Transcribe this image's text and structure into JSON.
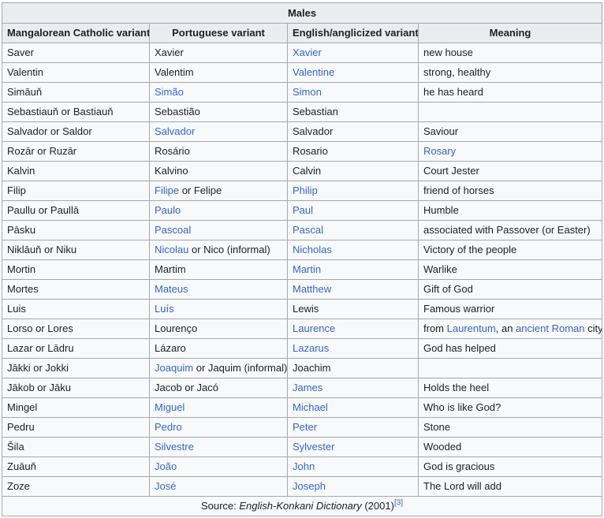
{
  "table": {
    "title": "Males",
    "headers": [
      "Mangalorean Catholic variant",
      "Portuguese variant",
      "English/anglicized variant",
      "Meaning"
    ],
    "rows": [
      [
        [
          {
            "t": "Saver"
          }
        ],
        [
          {
            "t": "Xavier"
          }
        ],
        [
          {
            "t": "Xavier",
            "link": true
          }
        ],
        [
          {
            "t": "new house"
          }
        ]
      ],
      [
        [
          {
            "t": "Valentin"
          }
        ],
        [
          {
            "t": "Valentim"
          }
        ],
        [
          {
            "t": "Valentine",
            "link": true
          }
        ],
        [
          {
            "t": "strong, healthy"
          }
        ]
      ],
      [
        [
          {
            "t": "Simāuň"
          }
        ],
        [
          {
            "t": "Simão",
            "link": true
          }
        ],
        [
          {
            "t": "Simon",
            "link": true
          }
        ],
        [
          {
            "t": "he has heard"
          }
        ]
      ],
      [
        [
          {
            "t": "Sebastiauň or Bastiauň"
          }
        ],
        [
          {
            "t": "Sebastião"
          }
        ],
        [
          {
            "t": "Sebastian"
          }
        ],
        []
      ],
      [
        [
          {
            "t": "Salvador or Saldor"
          }
        ],
        [
          {
            "t": "Salvador",
            "link": true
          }
        ],
        [
          {
            "t": "Salvador"
          }
        ],
        [
          {
            "t": "Saviour"
          }
        ]
      ],
      [
        [
          {
            "t": "Rozār or Ruzār"
          }
        ],
        [
          {
            "t": "Rosário"
          }
        ],
        [
          {
            "t": "Rosario"
          }
        ],
        [
          {
            "t": "Rosary",
            "link": true
          }
        ]
      ],
      [
        [
          {
            "t": "Kalvin"
          }
        ],
        [
          {
            "t": "Kalvino"
          }
        ],
        [
          {
            "t": "Calvin"
          }
        ],
        [
          {
            "t": "Court Jester"
          }
        ]
      ],
      [
        [
          {
            "t": "Filip"
          }
        ],
        [
          {
            "t": "Filipe",
            "link": true
          },
          {
            "t": " or Felipe"
          }
        ],
        [
          {
            "t": "Philip",
            "link": true
          }
        ],
        [
          {
            "t": "friend of horses"
          }
        ]
      ],
      [
        [
          {
            "t": "Paullu or Paullā"
          }
        ],
        [
          {
            "t": "Paulo",
            "link": true
          }
        ],
        [
          {
            "t": "Paul",
            "link": true
          }
        ],
        [
          {
            "t": "Humble"
          }
        ]
      ],
      [
        [
          {
            "t": "Pāsku"
          }
        ],
        [
          {
            "t": "Pascoal",
            "link": true
          }
        ],
        [
          {
            "t": "Pascal",
            "link": true
          }
        ],
        [
          {
            "t": "associated with Passover (or Easter)"
          }
        ]
      ],
      [
        [
          {
            "t": "Niklāuň or Niku"
          }
        ],
        [
          {
            "t": "Nicolau",
            "link": true
          },
          {
            "t": " or Nico (informal)"
          }
        ],
        [
          {
            "t": "Nicholas",
            "link": true
          }
        ],
        [
          {
            "t": "Victory of the people"
          }
        ]
      ],
      [
        [
          {
            "t": "Mortin"
          }
        ],
        [
          {
            "t": "Martim"
          }
        ],
        [
          {
            "t": "Martin",
            "link": true
          }
        ],
        [
          {
            "t": "Warlike"
          }
        ]
      ],
      [
        [
          {
            "t": "Mortes"
          }
        ],
        [
          {
            "t": "Mateus",
            "link": true
          }
        ],
        [
          {
            "t": "Matthew",
            "link": true
          }
        ],
        [
          {
            "t": "Gift of God"
          }
        ]
      ],
      [
        [
          {
            "t": "Luis"
          }
        ],
        [
          {
            "t": "Luís",
            "link": true
          }
        ],
        [
          {
            "t": "Lewis"
          }
        ],
        [
          {
            "t": "Famous warrior"
          }
        ]
      ],
      [
        [
          {
            "t": "Lorso or Lores"
          }
        ],
        [
          {
            "t": "Lourenço"
          }
        ],
        [
          {
            "t": "Laurence",
            "link": true
          }
        ],
        [
          {
            "t": "from "
          },
          {
            "t": "Laurentum",
            "link": true
          },
          {
            "t": ", an "
          },
          {
            "t": "ancient Roman",
            "link": true
          },
          {
            "t": " city"
          }
        ]
      ],
      [
        [
          {
            "t": "Lazar or Lādru"
          }
        ],
        [
          {
            "t": "Lázaro"
          }
        ],
        [
          {
            "t": "Lazarus",
            "link": true
          }
        ],
        [
          {
            "t": "God has helped"
          }
        ]
      ],
      [
        [
          {
            "t": "Jākki or Jokki"
          }
        ],
        [
          {
            "t": "Joaquim",
            "link": true
          },
          {
            "t": " or Jaquim (informal)"
          }
        ],
        [
          {
            "t": "Joachim"
          }
        ],
        []
      ],
      [
        [
          {
            "t": "Jākob or Jāku"
          }
        ],
        [
          {
            "t": "Jacob or Jacó"
          }
        ],
        [
          {
            "t": "James",
            "link": true
          }
        ],
        [
          {
            "t": "Holds the heel"
          }
        ]
      ],
      [
        [
          {
            "t": "Mingel"
          }
        ],
        [
          {
            "t": "Miguel",
            "link": true
          }
        ],
        [
          {
            "t": "Michael",
            "link": true
          }
        ],
        [
          {
            "t": "Who is like God?"
          }
        ]
      ],
      [
        [
          {
            "t": "Pedru"
          }
        ],
        [
          {
            "t": "Pedro",
            "link": true
          }
        ],
        [
          {
            "t": "Peter",
            "link": true
          }
        ],
        [
          {
            "t": "Stone"
          }
        ]
      ],
      [
        [
          {
            "t": "Šila"
          }
        ],
        [
          {
            "t": "Silvestre",
            "link": true
          }
        ],
        [
          {
            "t": "Sylvester",
            "link": true
          }
        ],
        [
          {
            "t": "Wooded"
          }
        ]
      ],
      [
        [
          {
            "t": "Zuāuň"
          }
        ],
        [
          {
            "t": "João",
            "link": true
          }
        ],
        [
          {
            "t": "John",
            "link": true
          }
        ],
        [
          {
            "t": "God is gracious"
          }
        ]
      ],
      [
        [
          {
            "t": "Zoze"
          }
        ],
        [
          {
            "t": "José",
            "link": true
          }
        ],
        [
          {
            "t": "Joseph",
            "link": true
          }
        ],
        [
          {
            "t": "The Lord will add"
          }
        ]
      ]
    ],
    "source": {
      "prefix": "Source: ",
      "title": "English-Konkani Dictionary",
      "suffix": " (2001)",
      "ref": "[3]"
    }
  }
}
